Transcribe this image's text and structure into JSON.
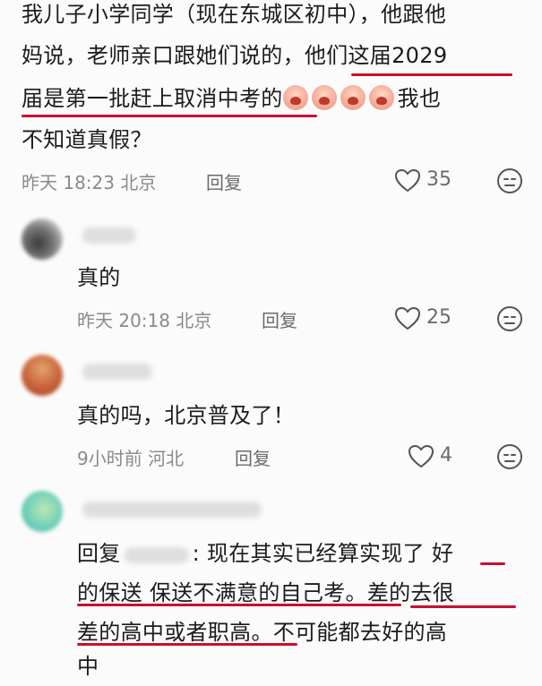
{
  "comment1": {
    "line1": "我儿子小学同学（现在东城区初中），他跟他",
    "line2a": "妈说，老师亲口跟她们说的，",
    "line2b": "他们这届2029",
    "line3a": "届是第一批赶上取消中考的",
    "line3b": "我也",
    "line4": "不知道真假？",
    "time": "昨天 18:23 北京",
    "reply": "回复",
    "likes": "35",
    "emoji": "crying-face-emoji"
  },
  "reply1": {
    "text": "真的",
    "time": "昨天 20:18 北京",
    "reply": "回复",
    "likes": "25"
  },
  "reply2": {
    "text": "真的吗，北京普及了！",
    "time": "9小时前 河北",
    "reply": "回复",
    "likes": "4"
  },
  "reply3": {
    "prefix": "回复",
    "line1": ": 现在其实已经算实现了 好",
    "line2": "的保送 保送不满意的自己考。差的去很",
    "line3": "差的高中或者职高。不可能都去好的高",
    "line4": "中"
  },
  "icons": {
    "like": "heart-outline-icon",
    "dislike": "neutral-face-icon"
  },
  "colors": {
    "underline": "#c8102e",
    "meta": "#8a8a8a"
  }
}
